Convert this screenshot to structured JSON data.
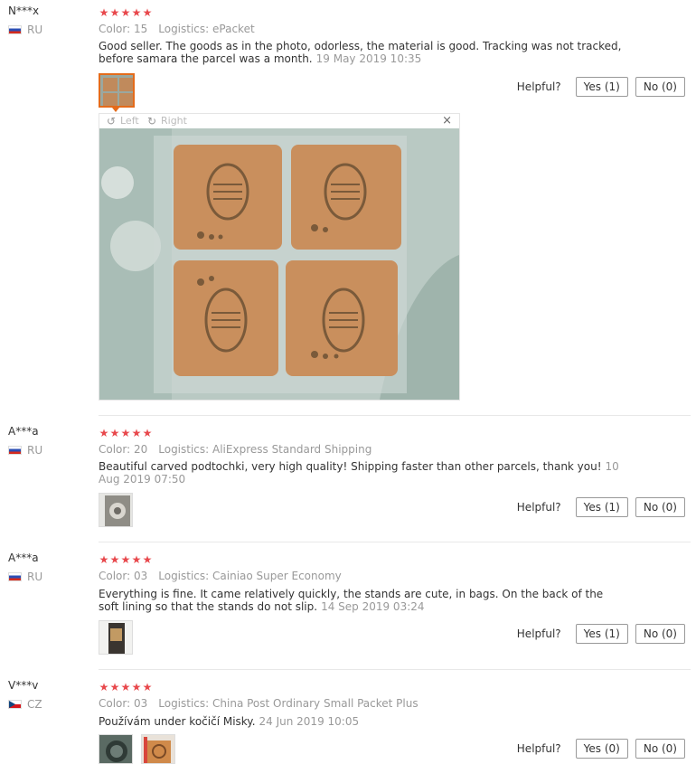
{
  "reviews": [
    {
      "user": "N***x",
      "country": "RU",
      "rating": 5,
      "stars": [
        "★",
        "★",
        "★",
        "★",
        "★"
      ],
      "color": "Color: 15",
      "logistics": "Logistics: ePacket",
      "text": "Good seller. The goods as in the photo, odorless, the material is good. Tracking was not tracked, before samara the parcel was a month.",
      "date": "19 May 2019 10:35",
      "helpful_label": "Helpful?",
      "yes_label": "Yes (1)",
      "no_label": "No (0)"
    },
    {
      "user": "A***a",
      "country": "RU",
      "rating": 5,
      "stars": [
        "★",
        "★",
        "★",
        "★",
        "★"
      ],
      "color": "Color: 20",
      "logistics": "Logistics: AliExpress Standard Shipping",
      "text": "Beautiful carved podtochki, very high quality! Shipping faster than other parcels, thank you!",
      "date": "10 Aug 2019 07:50",
      "helpful_label": "Helpful?",
      "yes_label": "Yes (1)",
      "no_label": "No (0)"
    },
    {
      "user": "A***a",
      "country": "RU",
      "rating": 5,
      "stars": [
        "★",
        "★",
        "★",
        "★",
        "★"
      ],
      "color": "Color: 03",
      "logistics": "Logistics: Cainiao Super Economy",
      "text": "Everything is fine. It came relatively quickly, the stands are cute, in bags. On the back of the soft lining so that the stands do not slip.",
      "date": "14 Sep 2019 03:24",
      "helpful_label": "Helpful?",
      "yes_label": "Yes (1)",
      "no_label": "No (0)"
    },
    {
      "user": "V***v",
      "country": "CZ",
      "rating": 5,
      "stars": [
        "★",
        "★",
        "★",
        "★",
        "★"
      ],
      "color": "Color: 03",
      "logistics": "Logistics: China Post Ordinary Small Packet Plus",
      "text": "Používám under kočičí Misky.",
      "date": "24 Jun 2019 10:05",
      "helpful_label": "Helpful?",
      "yes_label": "Yes (0)",
      "no_label": "No (0)"
    }
  ],
  "viewer": {
    "rotate_left_label": "Left",
    "rotate_right_label": "Right",
    "close_glyph": "×",
    "rotate_left_icon": "rotate-left-icon",
    "rotate_right_icon": "rotate-right-icon"
  },
  "colors": {
    "star": "#e8484c",
    "muted": "#999999",
    "active_thumb": "#e46b1b"
  }
}
